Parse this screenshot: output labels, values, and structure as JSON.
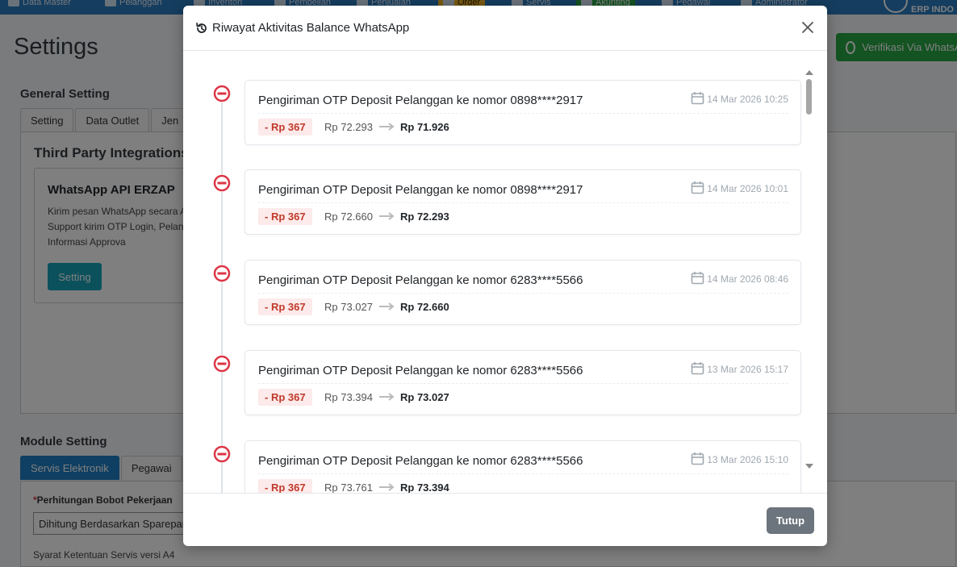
{
  "topnav": {
    "items": [
      {
        "label": "Data Master",
        "icon": "list-icon"
      },
      {
        "label": "Pelanggan",
        "icon": "users-icon"
      },
      {
        "label": "Inventori",
        "icon": "box-icon"
      },
      {
        "label": "Pembelian",
        "icon": "cart-icon"
      },
      {
        "label": "Penjualan",
        "icon": "receipt-icon"
      },
      {
        "label": "Order",
        "icon": "order-icon"
      },
      {
        "label": "Servis",
        "icon": "gear-icon"
      },
      {
        "label": "Akunting",
        "icon": "ledger-icon"
      },
      {
        "label": "Pegawai",
        "icon": "employee-icon"
      },
      {
        "label": "Administrator",
        "icon": "admin-icon"
      }
    ],
    "brand": "ERP INDO"
  },
  "page": {
    "title": "Settings",
    "verify_button": "Verifikasi Via WhatsApp",
    "general_setting_label": "General Setting",
    "general_tabs": [
      "Setting",
      "Data Outlet",
      "Jen"
    ],
    "third_party_title": "Third Party Integrations",
    "wa_card": {
      "title": "WhatsApp API ERZAP",
      "description": "Kirim pesan WhatsApp secara API. Support kirim OTP Login, Pelanggan, Informasi Approva",
      "button": "Setting"
    },
    "module_setting_label": "Module Setting",
    "module_tabs": [
      "Servis Elektronik",
      "Pegawai"
    ],
    "field_label": "Perhitungan Bobot Pekerjaan",
    "field_required_mark": "*",
    "field_value": "Dihitung Berdasarkan Sparepart",
    "field_note": "Syarat Ketentuan Servis versi A4"
  },
  "modal": {
    "title": "Riwayat Aktivitas Balance WhatsApp",
    "close_button": "Tutup",
    "items": [
      {
        "description": "Pengiriman OTP Deposit Pelanggan ke nomor 0898****2917",
        "date": "14 Mar 2026 10:25",
        "amount": "- Rp 367",
        "before": "Rp 72.293",
        "after": "Rp 71.926"
      },
      {
        "description": "Pengiriman OTP Deposit Pelanggan ke nomor 0898****2917",
        "date": "14 Mar 2026 10:01",
        "amount": "- Rp 367",
        "before": "Rp 72.660",
        "after": "Rp 72.293"
      },
      {
        "description": "Pengiriman OTP Deposit Pelanggan ke nomor 6283****5566",
        "date": "14 Mar 2026 08:46",
        "amount": "- Rp 367",
        "before": "Rp 73.027",
        "after": "Rp 72.660"
      },
      {
        "description": "Pengiriman OTP Deposit Pelanggan ke nomor 6283****5566",
        "date": "13 Mar 2026 15:17",
        "amount": "- Rp 367",
        "before": "Rp 73.394",
        "after": "Rp 73.027"
      },
      {
        "description": "Pengiriman OTP Deposit Pelanggan ke nomor 6283****5566",
        "date": "13 Mar 2026 15:10",
        "amount": "- Rp 367",
        "before": "Rp 73.761",
        "after": "Rp 73.394"
      }
    ]
  },
  "colors": {
    "primary": "#1e7fc4",
    "success": "#28a745",
    "danger": "#dc3545",
    "secondary": "#6c757d"
  }
}
